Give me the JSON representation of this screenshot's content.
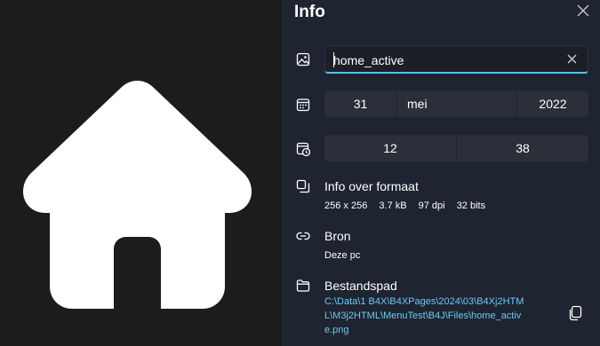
{
  "panel": {
    "title": "Info",
    "close_icon": "close-icon"
  },
  "name": {
    "icon": "image-icon",
    "value": "home_active",
    "clear_icon": "clear-icon"
  },
  "date": {
    "icon": "calendar-icon",
    "day": "31",
    "month": "mei",
    "year": "2022"
  },
  "time": {
    "icon": "clock-icon",
    "hour": "12",
    "minute": "38"
  },
  "format": {
    "icon": "resize-icon",
    "label": "Info over formaat",
    "dimensions": "256 x 256",
    "size": "3.7 kB",
    "dpi": "97 dpi",
    "bits": "32 bits"
  },
  "source": {
    "icon": "link-icon",
    "label": "Bron",
    "value": "Deze pc"
  },
  "file_path": {
    "icon": "folder-icon",
    "label": "Bestandspad",
    "value": "C:\\Data\\1 B4X\\B4XPages\\2024\\03\\B4Xj2HTML\\M3j2HTML\\MenuTest\\B4J\\Files\\home_active.png",
    "copy_icon": "copy-icon"
  },
  "preview": {
    "icon": "house-icon"
  },
  "colors": {
    "accent": "#4cc2ff",
    "link": "#6ec8f5",
    "panel_bg": "#1e2430",
    "field_bg": "#2a2f39"
  }
}
